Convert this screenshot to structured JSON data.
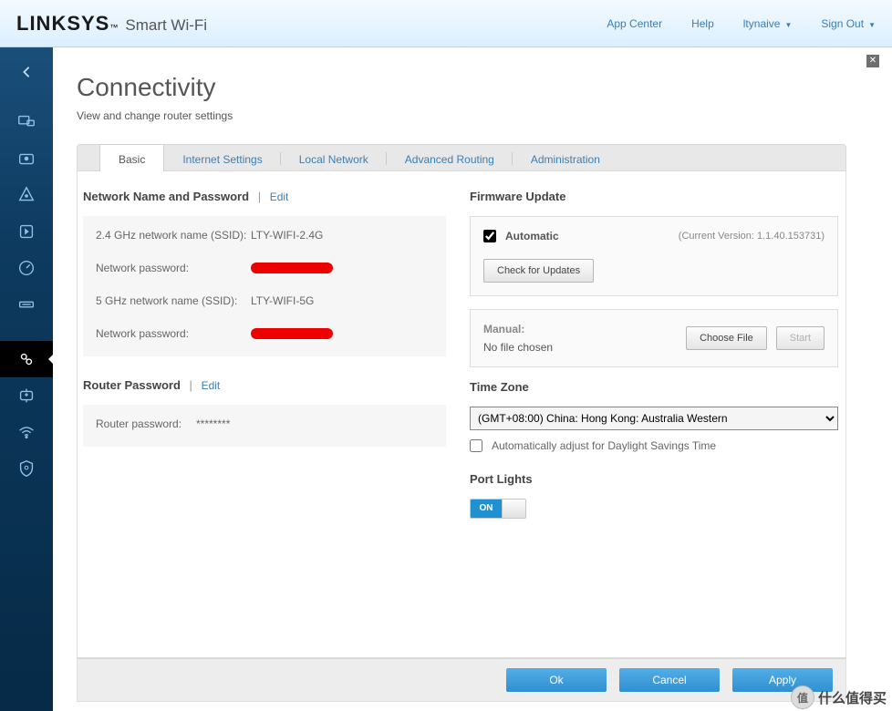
{
  "header": {
    "brand": "LINKSYS",
    "brand_tm": "™",
    "tagline": "Smart Wi-Fi",
    "nav": {
      "app_center": "App Center",
      "help": "Help",
      "user": "ltynaive",
      "sign_out": "Sign Out"
    }
  },
  "page": {
    "title": "Connectivity",
    "subtitle": "View and change router settings"
  },
  "tabs": {
    "basic": "Basic",
    "internet": "Internet Settings",
    "local": "Local Network",
    "routing": "Advanced Routing",
    "admin": "Administration"
  },
  "network": {
    "heading": "Network Name and Password",
    "edit": "Edit",
    "ssid24_label": "2.4 GHz network name (SSID):",
    "ssid24_value": "LTY-WIFI-2.4G",
    "pass24_label": "Network password:",
    "ssid5_label": "5 GHz network name (SSID):",
    "ssid5_value": "LTY-WIFI-5G",
    "pass5_label": "Network password:"
  },
  "router_pw": {
    "heading": "Router Password",
    "edit": "Edit",
    "label": "Router password:",
    "value": "********"
  },
  "firmware": {
    "heading": "Firmware Update",
    "auto_label": "Automatic",
    "version": "(Current Version: 1.1.40.153731)",
    "check_btn": "Check for Updates",
    "manual_label": "Manual:",
    "no_file": "No file chosen",
    "choose_btn": "Choose File",
    "start_btn": "Start"
  },
  "timezone": {
    "heading": "Time Zone",
    "selected": "(GMT+08:00) China: Hong Kong: Australia Western",
    "dst_label": "Automatically adjust for Daylight Savings Time"
  },
  "port_lights": {
    "heading": "Port Lights",
    "on_label": "ON"
  },
  "footer": {
    "ok": "Ok",
    "cancel": "Cancel",
    "apply": "Apply"
  },
  "watermark": {
    "icon": "值",
    "text": "什么值得买"
  }
}
